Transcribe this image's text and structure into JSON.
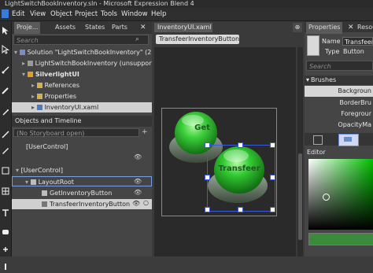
{
  "window": {
    "title": "LightSwitchBookInventory.sln - Microsoft Expression Blend 4"
  },
  "menu": [
    "Edit",
    "View",
    "Object",
    "Project",
    "Tools",
    "Window",
    "Help"
  ],
  "left_tabs": [
    "Proje...",
    "Assets",
    "States",
    "Parts"
  ],
  "project_search_placeholder": "Search",
  "project_tree": [
    "Solution \"LightSwitchBookInventory\" (2 project",
    "LightSwitchBookInventory (unsupported p",
    "SilverlightUI",
    "References",
    "Properties",
    "InventoryUI.xaml"
  ],
  "objects_header": "Objects and Timeline",
  "storyboard_text": "(No Storyboard open)",
  "objects_tree": [
    "[UserControl]",
    "[UserControl]",
    "LayoutRoot",
    "GetInventoryButton",
    "TransfeerInventoryButton"
  ],
  "document_tab": "InventoryUI.xaml",
  "breadcrumb": "TransfeerInventoryButton",
  "buttons": {
    "get": "Get",
    "transfer": "Transfeer"
  },
  "properties": {
    "tab_label": "Properties",
    "tab2_label": "Resou",
    "name_label": "Name",
    "name_value": "TransfeerI",
    "type_label": "Type",
    "type_value": "Button",
    "search_placeholder": "Search",
    "brushes_header": "Brushes",
    "brushes": [
      "Backgroun",
      "BorderBru",
      "Foregrour",
      "OpacityMa"
    ],
    "editor_label": "Editor"
  },
  "colors": {
    "button_green": "#22b022",
    "selection": "#3a5ad8"
  }
}
